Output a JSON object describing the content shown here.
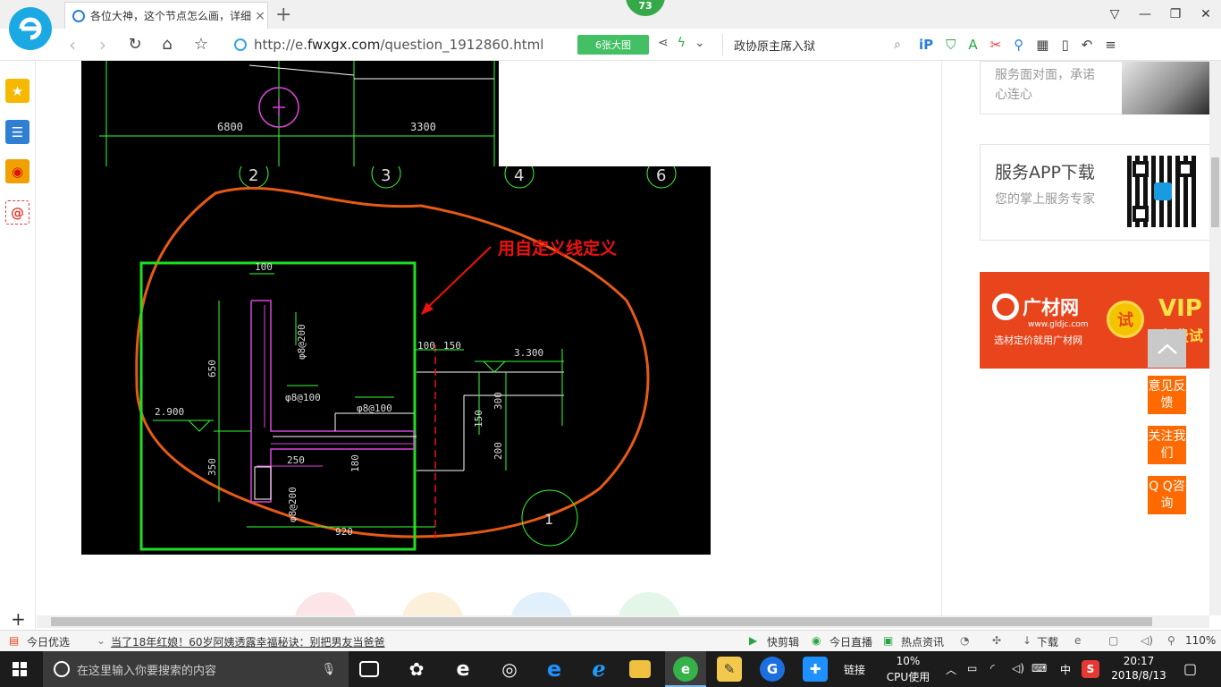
{
  "browser": {
    "tab_title": "各位大神，这个节点怎么画，详细",
    "tab_close": "×",
    "new_tab": "+",
    "badge": "73",
    "url_prefix": "http://e.",
    "url_domain": "fwxgx.com",
    "url_path": "/question_1912860.html",
    "big_image_label": "6张大图",
    "search_text": "政协原主席入狱",
    "window_controls": [
      "▽",
      "—",
      "❐",
      "✕"
    ]
  },
  "cad": {
    "axis_numbers": [
      "2",
      "3",
      "4",
      "6"
    ],
    "dims_top": [
      "6800",
      "3300"
    ],
    "annotation": "用自定义线定义",
    "dims": {
      "d100_top": "100",
      "d650": "650",
      "d350": "350",
      "d2900": "2.900",
      "rebar_a8_200_top": "φ8@200",
      "rebar_a8_100": "φ8@100",
      "rebar_a8_100_b": "φ8@100",
      "d100_right": "100",
      "d150": "150",
      "d3300": "3.300",
      "d300": "300",
      "d150_v": "150",
      "d200": "200",
      "d250": "250",
      "d180": "180",
      "rebar_a8_200_bot": "φ8@200",
      "d920": "920",
      "circle_label": "1"
    }
  },
  "sidebar": {
    "card1_text": "服务面对面，承诺心连心",
    "card2_title": "服务APP下载",
    "card2_sub": "您的掌上服务专家",
    "ad_name": "广材网",
    "ad_url": "www.gldjc.com",
    "ad_slogan": "选材定价就用广材网",
    "ad_badge": "试",
    "ad_vip": "VIP",
    "ad_vip2": "免费试用",
    "btn_feedback": "意见反馈",
    "btn_follow": "关注我们",
    "btn_qq": "Q Q咨询"
  },
  "statusbar": {
    "today": "今日优选",
    "news": "当了18年红娘！60岁阿姨透露幸福秘诀：别把男友当爸爸",
    "kuaijian": "快剪辑",
    "live": "今日直播",
    "hot": "热点资讯",
    "download": "下载",
    "zoom": "110%"
  },
  "taskbar": {
    "search_placeholder": "在这里输入你要搜索的内容",
    "link_label": "链接",
    "cpu_pct": "10%",
    "cpu_label": "CPU使用",
    "ime": "中",
    "time": "20:17",
    "date": "2018/8/13"
  }
}
